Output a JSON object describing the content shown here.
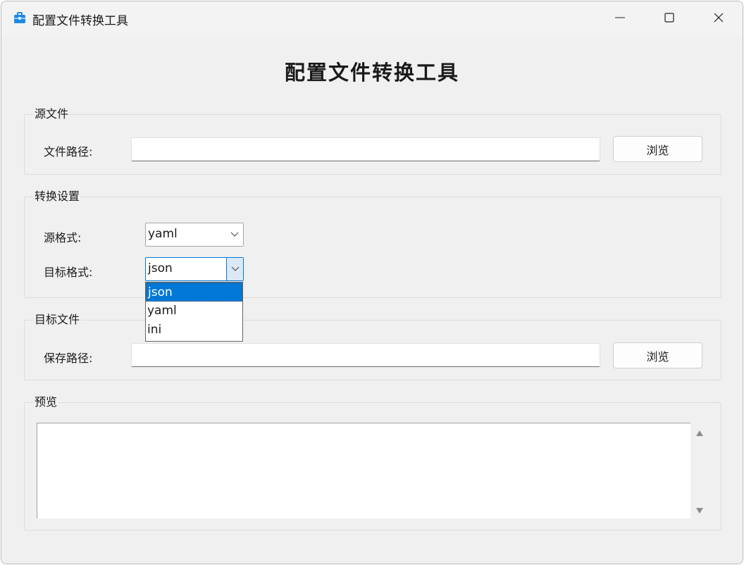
{
  "window": {
    "title": "配置文件转换工具",
    "icon": "toolbox-icon",
    "controls": [
      "minimize-icon",
      "maximize-icon",
      "close-icon"
    ]
  },
  "heading": "配置文件转换工具",
  "source_group": {
    "title": "源文件",
    "path_label": "文件路径:",
    "path_value": "",
    "browse_label": "浏览"
  },
  "convert_group": {
    "title": "转换设置",
    "source_format_label": "源格式:",
    "source_format_value": "yaml",
    "target_format_label": "目标格式:",
    "target_format_value": "json",
    "target_format_options": [
      "json",
      "yaml",
      "ini"
    ],
    "selected_option": "json"
  },
  "target_group": {
    "title": "目标文件",
    "path_label": "保存路径:",
    "path_value": "",
    "browse_label": "浏览"
  },
  "preview_group": {
    "title": "预览",
    "content": ""
  },
  "colors": {
    "accent": "#0078d7",
    "window_bg": "#f0f0f0",
    "icon_blue": "#1e88e5"
  }
}
